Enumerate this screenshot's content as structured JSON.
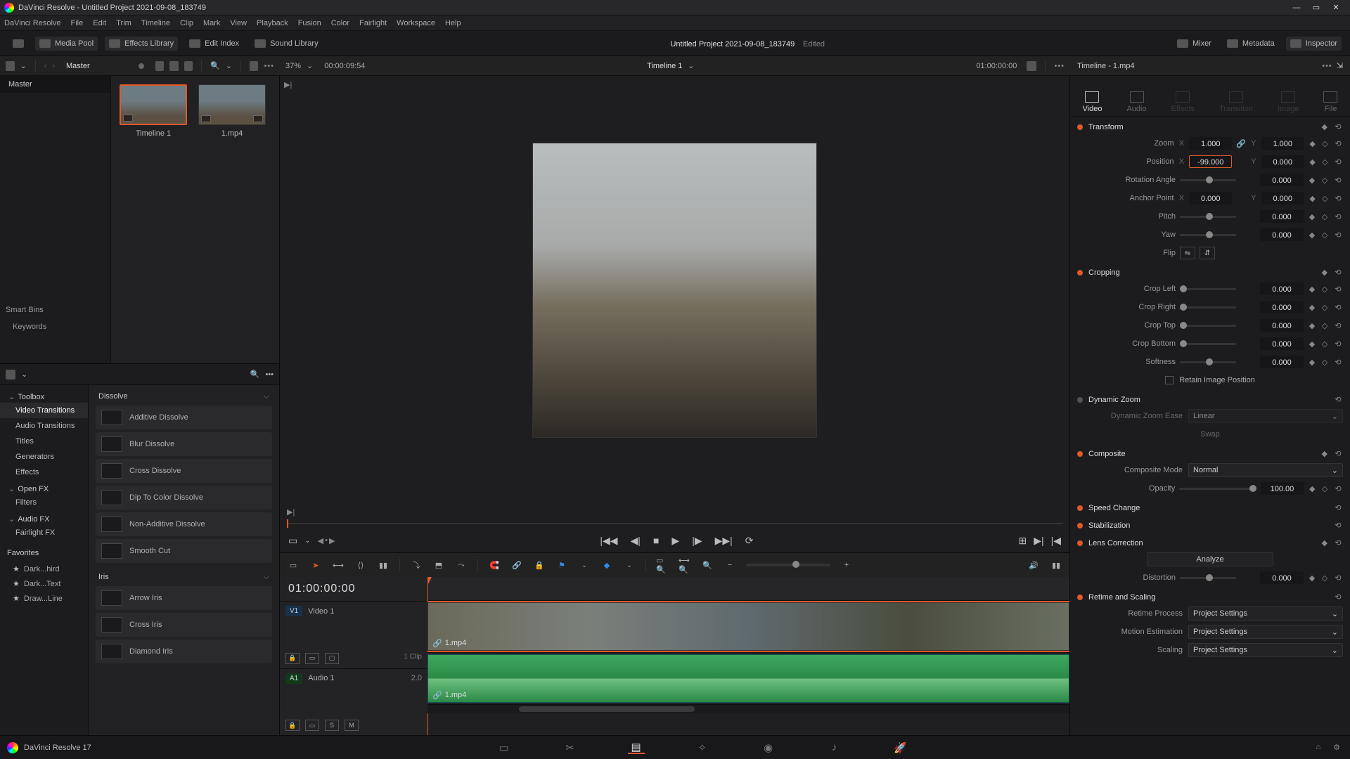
{
  "titlebar": {
    "title": "DaVinci Resolve - Untitled Project 2021-09-08_183749"
  },
  "menu": [
    "DaVinci Resolve",
    "File",
    "Edit",
    "Trim",
    "Timeline",
    "Clip",
    "Mark",
    "View",
    "Playback",
    "Fusion",
    "Color",
    "Fairlight",
    "Workspace",
    "Help"
  ],
  "header": {
    "mediaPool": "Media Pool",
    "effectsLib": "Effects Library",
    "editIndex": "Edit Index",
    "soundLib": "Sound Library",
    "project": "Untitled Project 2021-09-08_183749",
    "edited": "Edited",
    "mixer": "Mixer",
    "metadata": "Metadata",
    "inspector": "Inspector"
  },
  "ctrl": {
    "master": "Master",
    "zoomPct": "37%",
    "srcTC": "00:00:09:54",
    "timelineName": "Timeline 1",
    "recTC": "01:00:00:00",
    "inspTitle": "Timeline - 1.mp4"
  },
  "mediapool": {
    "root": "Master",
    "smartBins": "Smart Bins",
    "keywords": "Keywords",
    "clips": [
      {
        "name": "Timeline 1"
      },
      {
        "name": "1.mp4"
      }
    ]
  },
  "fx": {
    "toolbox": "Toolbox",
    "items": [
      "Video Transitions",
      "Audio Transitions",
      "Titles",
      "Generators",
      "Effects"
    ],
    "openfx": "Open FX",
    "filters": "Filters",
    "audiofx": "Audio FX",
    "fairlight": "Fairlight FX",
    "favHdr": "Favorites",
    "favs": [
      "Dark...hird",
      "Dark...Text",
      "Draw...Line"
    ],
    "cat1": "Dissolve",
    "dissolves": [
      "Additive Dissolve",
      "Blur Dissolve",
      "Cross Dissolve",
      "Dip To Color Dissolve",
      "Non-Additive Dissolve",
      "Smooth Cut"
    ],
    "cat2": "Iris",
    "iris": [
      "Arrow Iris",
      "Cross Iris",
      "Diamond Iris"
    ]
  },
  "timeline": {
    "tc": "01:00:00:00",
    "v1": "V1",
    "v1name": "Video 1",
    "v1clips": "1 Clip",
    "a1": "A1",
    "a1name": "Audio 1",
    "a1ch": "2.0",
    "clipName": "1.mp4",
    "solo": "S",
    "mute": "M"
  },
  "insp": {
    "tabs": [
      "Video",
      "Audio",
      "Effects",
      "Transition",
      "Image",
      "File"
    ],
    "transform": "Transform",
    "zoom": "Zoom",
    "zx": "1.000",
    "zy": "1.000",
    "position": "Position",
    "px": "-99.000",
    "py": "0.000",
    "rotation": "Rotation Angle",
    "rv": "0.000",
    "anchor": "Anchor Point",
    "ax": "0.000",
    "ay": "0.000",
    "pitch": "Pitch",
    "pv": "0.000",
    "yaw": "Yaw",
    "yv": "0.000",
    "flip": "Flip",
    "cropping": "Cropping",
    "cl": "Crop Left",
    "cr": "Crop Right",
    "ct": "Crop Top",
    "cb": "Crop Bottom",
    "soft": "Softness",
    "c0": "0.000",
    "retain": "Retain Image Position",
    "dz": "Dynamic Zoom",
    "dze": "Dynamic Zoom Ease",
    "dzeVal": "Linear",
    "swap": "Swap",
    "comp": "Composite",
    "compMode": "Composite Mode",
    "compVal": "Normal",
    "opacity": "Opacity",
    "opv": "100.00",
    "speed": "Speed Change",
    "stab": "Stabilization",
    "lens": "Lens Correction",
    "analyze": "Analyze",
    "dist": "Distortion",
    "dv": "0.000",
    "ret": "Retime and Scaling",
    "retp": "Retime Process",
    "me": "Motion Estimation",
    "sc": "Scaling",
    "ps": "Project Settings"
  },
  "footer": {
    "app": "DaVinci Resolve 17"
  }
}
